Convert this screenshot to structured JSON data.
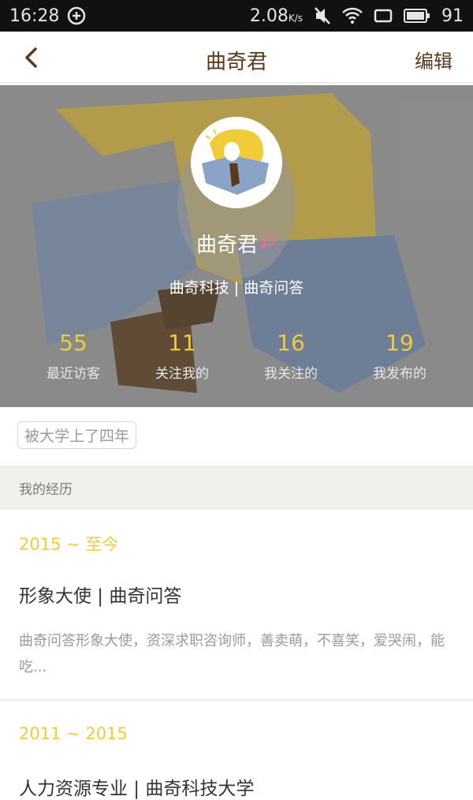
{
  "status_bar": {
    "time": "16:28",
    "network_speed": "2.08",
    "network_unit": "K/s",
    "battery": "91",
    "icons": [
      "sync-icon",
      "mute-icon",
      "wifi-icon",
      "screen-rotate-icon",
      "battery-icon"
    ]
  },
  "nav": {
    "title": "曲奇君",
    "edit_label": "编辑"
  },
  "profile": {
    "name": "曲奇君",
    "company": "曲奇科技 | 曲奇问答",
    "stats": [
      {
        "num": "55",
        "label": "最近访客"
      },
      {
        "num": "11",
        "label": "关注我的"
      },
      {
        "num": "16",
        "label": "我关注的"
      },
      {
        "num": "19",
        "label": "我发布的"
      }
    ],
    "tag": "被大学上了四年",
    "colors": {
      "accent": "#f1cc3a",
      "brand_brown": "#5a3a1a",
      "female": "#e86f9a"
    }
  },
  "experience": {
    "section_title": "我的经历",
    "items": [
      {
        "period": "2015 ~ 至今",
        "role": "形象大使 | 曲奇问答",
        "desc": "曲奇问答形象大使，资深求职咨询师，善卖萌，不喜笑，爱哭闹，能吃..."
      },
      {
        "period": "2011 ~ 2015",
        "role": "人力资源专业 | 曲奇科技大学"
      }
    ]
  }
}
